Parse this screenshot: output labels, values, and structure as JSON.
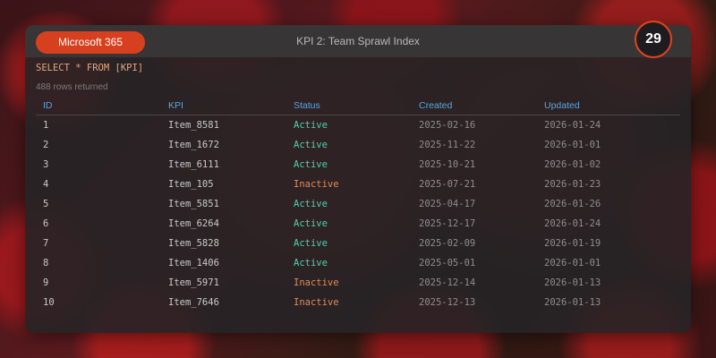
{
  "window": {
    "brand_label": "Microsoft 365",
    "title": "KPI 2: Team Sprawl Index",
    "counter": "29"
  },
  "query": {
    "sql": "SELECT * FROM [KPI]",
    "row_count_text": "488 rows returned"
  },
  "table": {
    "columns": [
      "ID",
      "KPI",
      "Status",
      "Created",
      "Updated"
    ],
    "rows": [
      {
        "id": "1",
        "kpi": "Item_8581",
        "status": "Active",
        "created": "2025-02-16",
        "updated": "2026-01-24"
      },
      {
        "id": "2",
        "kpi": "Item_1672",
        "status": "Active",
        "created": "2025-11-22",
        "updated": "2026-01-01"
      },
      {
        "id": "3",
        "kpi": "Item_6111",
        "status": "Active",
        "created": "2025-10-21",
        "updated": "2026-01-02"
      },
      {
        "id": "4",
        "kpi": "Item_105",
        "status": "Inactive",
        "created": "2025-07-21",
        "updated": "2026-01-23"
      },
      {
        "id": "5",
        "kpi": "Item_5851",
        "status": "Active",
        "created": "2025-04-17",
        "updated": "2026-01-26"
      },
      {
        "id": "6",
        "kpi": "Item_6264",
        "status": "Active",
        "created": "2025-12-17",
        "updated": "2026-01-24"
      },
      {
        "id": "7",
        "kpi": "Item_5828",
        "status": "Active",
        "created": "2025-02-09",
        "updated": "2026-01-19"
      },
      {
        "id": "8",
        "kpi": "Item_1406",
        "status": "Active",
        "created": "2025-05-01",
        "updated": "2026-01-01"
      },
      {
        "id": "9",
        "kpi": "Item_5971",
        "status": "Inactive",
        "created": "2025-12-14",
        "updated": "2026-01-13"
      },
      {
        "id": "10",
        "kpi": "Item_7646",
        "status": "Inactive",
        "created": "2025-12-13",
        "updated": "2026-01-13"
      }
    ]
  },
  "colors": {
    "brand": "#d7401f",
    "header_text": "#5aa6e0",
    "active": "#4fd1b0",
    "inactive": "#e08a58",
    "query_text": "#e0a87e"
  }
}
